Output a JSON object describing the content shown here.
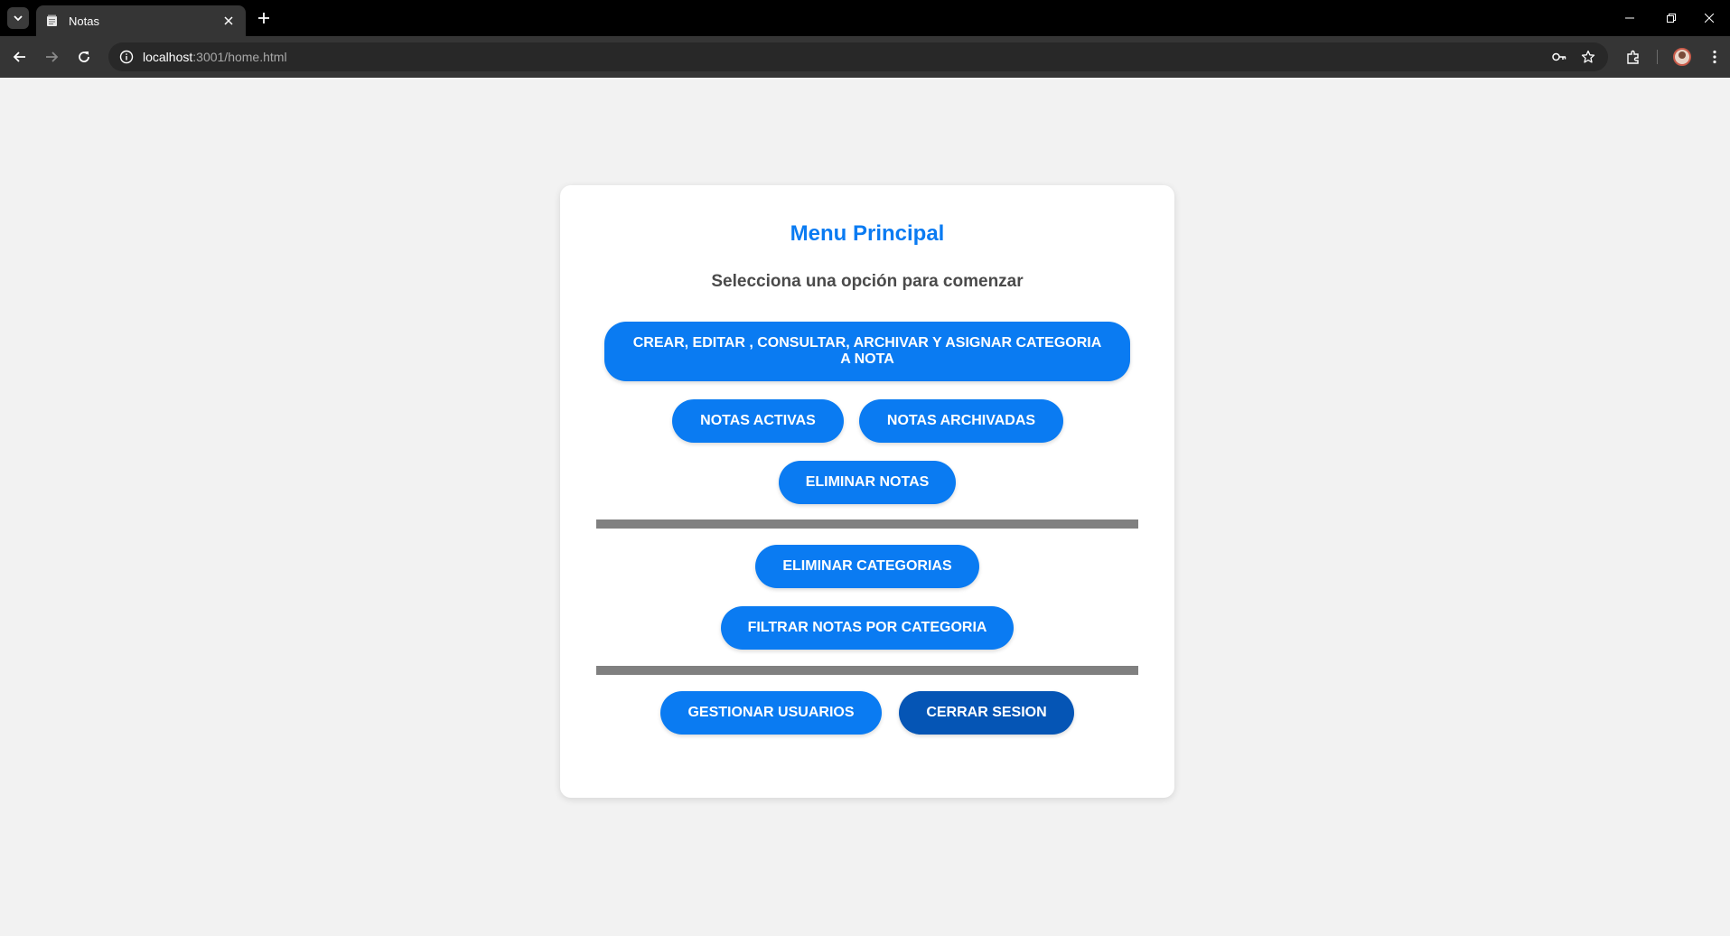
{
  "browser": {
    "tab_title": "Notas",
    "url_host": "localhost",
    "url_rest": ":3001/home.html"
  },
  "page": {
    "title": "Menu Principal",
    "subtitle": "Selecciona una opción para comenzar",
    "buttons": {
      "crear": "CREAR, EDITAR , CONSULTAR, ARCHIVAR Y ASIGNAR CATEGORIA A NOTA",
      "activas": "NOTAS ACTIVAS",
      "archivadas": "NOTAS ARCHIVADAS",
      "eliminar_notas": "ELIMINAR NOTAS",
      "eliminar_categorias": "ELIMINAR CATEGORIAS",
      "filtrar": "FILTRAR NOTAS POR CATEGORIA",
      "gestionar_usuarios": "GESTIONAR USUARIOS",
      "cerrar_sesion": "CERRAR SESION"
    }
  },
  "colors": {
    "primary": "#0a7bf2",
    "logout": "#0555b5",
    "divider": "#808080",
    "background": "#f2f2f2"
  },
  "icons": [
    "tab-list-icon",
    "notepad-favicon-icon",
    "close-icon",
    "plus-icon",
    "minimize-icon",
    "restore-icon",
    "window-close-icon",
    "back-arrow-icon",
    "forward-arrow-icon",
    "reload-icon",
    "site-info-icon",
    "key-icon",
    "star-icon",
    "puzzle-icon",
    "avatar",
    "kebab-menu-icon"
  ]
}
